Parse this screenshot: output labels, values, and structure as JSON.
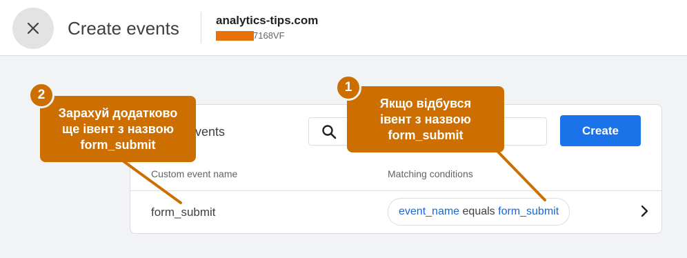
{
  "header": {
    "title": "Create events",
    "account_name": "analytics-tips.com",
    "account_id_suffix": "7168VF"
  },
  "card": {
    "title": "Custom events",
    "title_visible_fragment": "n events",
    "search": {
      "placeholder": "",
      "value": ""
    },
    "create_label": "Create",
    "columns": [
      "Custom event name",
      "Matching conditions"
    ],
    "rows": [
      {
        "event_name": "form_submit",
        "condition": {
          "parameter": "event_name",
          "operator": "equals",
          "value": "form_submit"
        }
      }
    ]
  },
  "annotations": [
    {
      "number": "1",
      "text_lines": [
        "Якщо відбувся",
        "івент з назвою",
        "form_submit"
      ]
    },
    {
      "number": "2",
      "text_lines": [
        "Зарахуй додатково",
        "ще івент з назвою",
        "form_submit"
      ]
    }
  ],
  "colors": {
    "primary": "#1a73e8",
    "link": "#1967d2",
    "annotation": "#cc6f00",
    "redaction": "#e8710a"
  },
  "icons": {
    "close": "close-icon",
    "search": "search-icon",
    "row_chevron": "chevron-right-icon"
  }
}
